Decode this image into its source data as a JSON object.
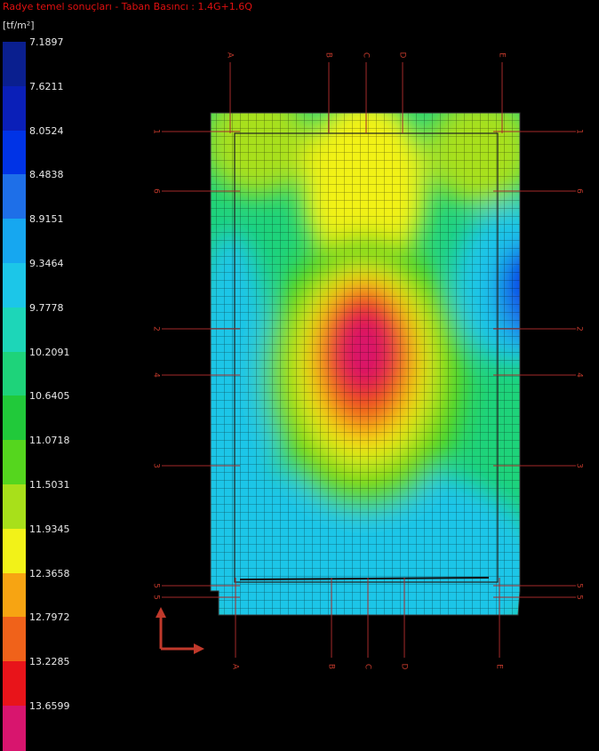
{
  "window": {
    "title": "Radye temel sonuçları - Taban Basıncı : 1.4G+1.6Q"
  },
  "legend": {
    "unit": "[tf/m²]",
    "levels": [
      {
        "value": "7.1897",
        "color": "#0a1f8f"
      },
      {
        "value": "7.6211",
        "color": "#0a1fb8"
      },
      {
        "value": "8.0524",
        "color": "#0033e6"
      },
      {
        "value": "8.4838",
        "color": "#1e6fe8"
      },
      {
        "value": "8.9151",
        "color": "#16a7f0"
      },
      {
        "value": "9.3464",
        "color": "#1cc6e8"
      },
      {
        "value": "9.7778",
        "color": "#1dd6b8"
      },
      {
        "value": "10.2091",
        "color": "#1ed37a"
      },
      {
        "value": "10.6405",
        "color": "#21c93a"
      },
      {
        "value": "11.0718",
        "color": "#55d61e"
      },
      {
        "value": "11.5031",
        "color": "#a8e01a"
      },
      {
        "value": "11.9345",
        "color": "#f2f218"
      },
      {
        "value": "12.3658",
        "color": "#f7a412"
      },
      {
        "value": "12.7972",
        "color": "#f0621a"
      },
      {
        "value": "13.2285",
        "color": "#e8141a"
      },
      {
        "value": "13.6599",
        "color": "#d8156e"
      }
    ]
  },
  "axes": {
    "vertical_top": [
      "A",
      "B",
      "C",
      "D",
      "E"
    ],
    "vertical_bottom": [
      "A",
      "B",
      "C",
      "D",
      "E"
    ],
    "horizontal_left": [
      "1",
      "6",
      "2",
      "4",
      "3",
      "5",
      "5"
    ],
    "horizontal_right": [
      "1",
      "6",
      "2",
      "4",
      "3",
      "5",
      "5"
    ]
  }
}
